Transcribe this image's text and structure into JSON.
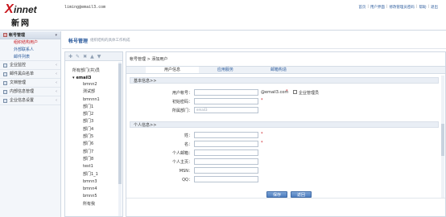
{
  "header": {
    "logo_x": "X",
    "logo_rest": "innet",
    "logo_cn": "新网",
    "email": "liming@email3.com",
    "links": [
      "首页",
      "用户界面",
      "修改管理员密码",
      "帮助",
      "退出"
    ]
  },
  "sidebar": {
    "head": "帐号管理",
    "sub_items": [
      {
        "label": "组织结构用户",
        "active": true
      },
      {
        "label": "外部联系人",
        "active": false
      },
      {
        "label": "邮件列表",
        "active": false
      }
    ],
    "items": [
      "企业监控",
      "邮件黑白名单",
      "文档管理",
      "内部信息管理",
      "企业信息设置"
    ]
  },
  "content": {
    "title": "帐号管理",
    "desc": "组织结构的具体工作构成"
  },
  "tree": {
    "root": "所有部门(共)员",
    "domain": "email3",
    "nodes": [
      "bmnn2",
      "测试部",
      "bmnnn1",
      "部门1",
      "部门2",
      "部门3",
      "部门4",
      "部门5",
      "部门6",
      "部门7",
      "部门8",
      "test1",
      "部门1_1",
      "bmnn3",
      "bmnn4",
      "bmnn5",
      "所有我"
    ]
  },
  "form": {
    "breadcrumb": "帐号管理 > 添加用户",
    "tabs": [
      "用户信息",
      "应用服务",
      "邮箱构造"
    ],
    "sec_basic": "基本信息>>",
    "account_label": "用户帐号：",
    "domain_suffix": "@email3.com",
    "admin_checkbox_label": "企业管理员",
    "password_label": "初始密码：",
    "dept_label": "所属部门：",
    "dept_value": "email3",
    "sec_personal": "个人信息>>",
    "surname_label": "姓：",
    "name_label": "名：",
    "personal_email_label": "个人邮箱：",
    "homepage_label": "个人主页：",
    "msn_label": "MSN：",
    "qq_label": "QQ：",
    "save_label": "保存",
    "back_label": "返回",
    "required": "*"
  }
}
